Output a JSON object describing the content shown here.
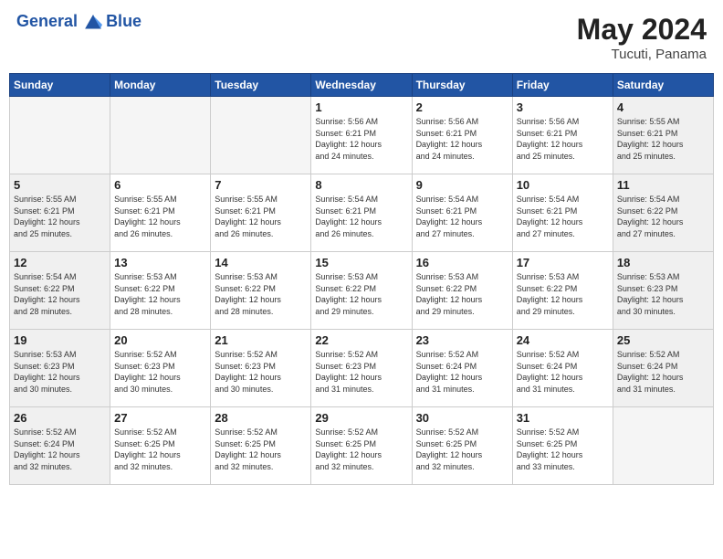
{
  "header": {
    "logo_line1": "General",
    "logo_line2": "Blue",
    "month": "May 2024",
    "location": "Tucuti, Panama"
  },
  "weekdays": [
    "Sunday",
    "Monday",
    "Tuesday",
    "Wednesday",
    "Thursday",
    "Friday",
    "Saturday"
  ],
  "weeks": [
    [
      {
        "day": "",
        "info": ""
      },
      {
        "day": "",
        "info": ""
      },
      {
        "day": "",
        "info": ""
      },
      {
        "day": "1",
        "info": "Sunrise: 5:56 AM\nSunset: 6:21 PM\nDaylight: 12 hours\nand 24 minutes."
      },
      {
        "day": "2",
        "info": "Sunrise: 5:56 AM\nSunset: 6:21 PM\nDaylight: 12 hours\nand 24 minutes."
      },
      {
        "day": "3",
        "info": "Sunrise: 5:56 AM\nSunset: 6:21 PM\nDaylight: 12 hours\nand 25 minutes."
      },
      {
        "day": "4",
        "info": "Sunrise: 5:55 AM\nSunset: 6:21 PM\nDaylight: 12 hours\nand 25 minutes."
      }
    ],
    [
      {
        "day": "5",
        "info": "Sunrise: 5:55 AM\nSunset: 6:21 PM\nDaylight: 12 hours\nand 25 minutes."
      },
      {
        "day": "6",
        "info": "Sunrise: 5:55 AM\nSunset: 6:21 PM\nDaylight: 12 hours\nand 26 minutes."
      },
      {
        "day": "7",
        "info": "Sunrise: 5:55 AM\nSunset: 6:21 PM\nDaylight: 12 hours\nand 26 minutes."
      },
      {
        "day": "8",
        "info": "Sunrise: 5:54 AM\nSunset: 6:21 PM\nDaylight: 12 hours\nand 26 minutes."
      },
      {
        "day": "9",
        "info": "Sunrise: 5:54 AM\nSunset: 6:21 PM\nDaylight: 12 hours\nand 27 minutes."
      },
      {
        "day": "10",
        "info": "Sunrise: 5:54 AM\nSunset: 6:21 PM\nDaylight: 12 hours\nand 27 minutes."
      },
      {
        "day": "11",
        "info": "Sunrise: 5:54 AM\nSunset: 6:22 PM\nDaylight: 12 hours\nand 27 minutes."
      }
    ],
    [
      {
        "day": "12",
        "info": "Sunrise: 5:54 AM\nSunset: 6:22 PM\nDaylight: 12 hours\nand 28 minutes."
      },
      {
        "day": "13",
        "info": "Sunrise: 5:53 AM\nSunset: 6:22 PM\nDaylight: 12 hours\nand 28 minutes."
      },
      {
        "day": "14",
        "info": "Sunrise: 5:53 AM\nSunset: 6:22 PM\nDaylight: 12 hours\nand 28 minutes."
      },
      {
        "day": "15",
        "info": "Sunrise: 5:53 AM\nSunset: 6:22 PM\nDaylight: 12 hours\nand 29 minutes."
      },
      {
        "day": "16",
        "info": "Sunrise: 5:53 AM\nSunset: 6:22 PM\nDaylight: 12 hours\nand 29 minutes."
      },
      {
        "day": "17",
        "info": "Sunrise: 5:53 AM\nSunset: 6:22 PM\nDaylight: 12 hours\nand 29 minutes."
      },
      {
        "day": "18",
        "info": "Sunrise: 5:53 AM\nSunset: 6:23 PM\nDaylight: 12 hours\nand 30 minutes."
      }
    ],
    [
      {
        "day": "19",
        "info": "Sunrise: 5:53 AM\nSunset: 6:23 PM\nDaylight: 12 hours\nand 30 minutes."
      },
      {
        "day": "20",
        "info": "Sunrise: 5:52 AM\nSunset: 6:23 PM\nDaylight: 12 hours\nand 30 minutes."
      },
      {
        "day": "21",
        "info": "Sunrise: 5:52 AM\nSunset: 6:23 PM\nDaylight: 12 hours\nand 30 minutes."
      },
      {
        "day": "22",
        "info": "Sunrise: 5:52 AM\nSunset: 6:23 PM\nDaylight: 12 hours\nand 31 minutes."
      },
      {
        "day": "23",
        "info": "Sunrise: 5:52 AM\nSunset: 6:24 PM\nDaylight: 12 hours\nand 31 minutes."
      },
      {
        "day": "24",
        "info": "Sunrise: 5:52 AM\nSunset: 6:24 PM\nDaylight: 12 hours\nand 31 minutes."
      },
      {
        "day": "25",
        "info": "Sunrise: 5:52 AM\nSunset: 6:24 PM\nDaylight: 12 hours\nand 31 minutes."
      }
    ],
    [
      {
        "day": "26",
        "info": "Sunrise: 5:52 AM\nSunset: 6:24 PM\nDaylight: 12 hours\nand 32 minutes."
      },
      {
        "day": "27",
        "info": "Sunrise: 5:52 AM\nSunset: 6:25 PM\nDaylight: 12 hours\nand 32 minutes."
      },
      {
        "day": "28",
        "info": "Sunrise: 5:52 AM\nSunset: 6:25 PM\nDaylight: 12 hours\nand 32 minutes."
      },
      {
        "day": "29",
        "info": "Sunrise: 5:52 AM\nSunset: 6:25 PM\nDaylight: 12 hours\nand 32 minutes."
      },
      {
        "day": "30",
        "info": "Sunrise: 5:52 AM\nSunset: 6:25 PM\nDaylight: 12 hours\nand 32 minutes."
      },
      {
        "day": "31",
        "info": "Sunrise: 5:52 AM\nSunset: 6:25 PM\nDaylight: 12 hours\nand 33 minutes."
      },
      {
        "day": "",
        "info": ""
      }
    ]
  ]
}
